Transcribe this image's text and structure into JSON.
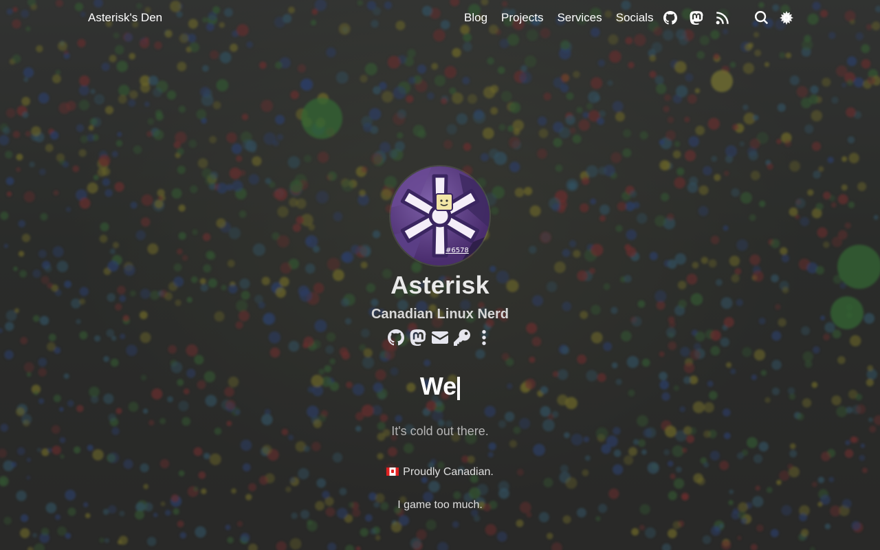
{
  "site": {
    "brand": "Asterisk's Den"
  },
  "nav": {
    "items": [
      {
        "label": "Blog"
      },
      {
        "label": "Projects"
      },
      {
        "label": "Services"
      },
      {
        "label": "Socials"
      }
    ],
    "icons": [
      "github-icon",
      "mastodon-icon",
      "rss-icon",
      "search-icon",
      "theme-toggle-icon"
    ]
  },
  "profile": {
    "avatar_tag": "#6578",
    "name": "Asterisk",
    "subtitle": "Canadian Linux Nerd",
    "social_icons": [
      "github-icon",
      "mastodon-icon",
      "email-icon",
      "key-icon",
      "more-icon"
    ]
  },
  "hero": {
    "typed_text": "We",
    "tagline": "It's cold out there.",
    "line1": "Proudly Canadian.",
    "line2": "I game too much."
  },
  "colors": {
    "text": "#ffffff",
    "subtitle": "#d8d8d8",
    "tagline": "#b7b7b7",
    "avatar_bg": "#4a2d6e"
  }
}
